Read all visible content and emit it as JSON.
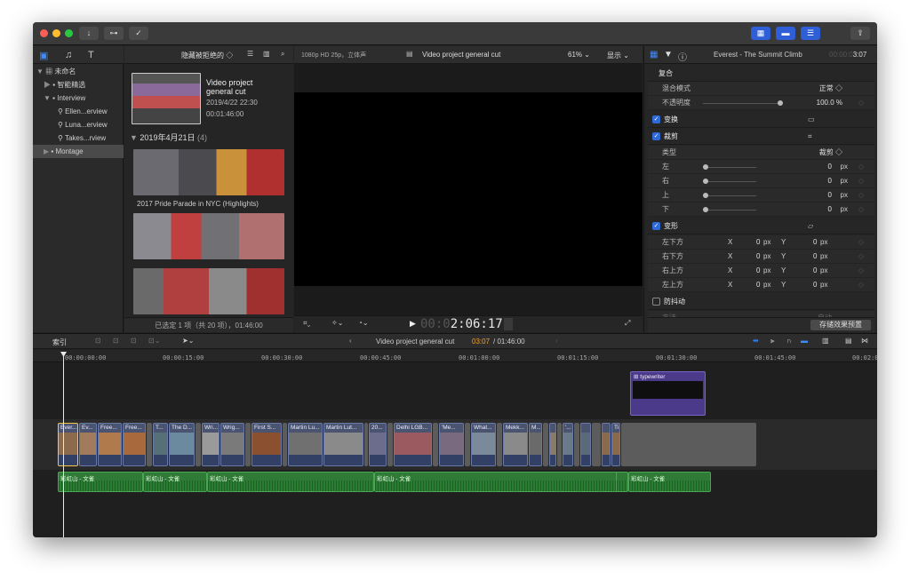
{
  "titlebar": {
    "download_icon": "download-icon",
    "key_icon": "key-icon",
    "check_icon": "checkmark-circle-icon",
    "share_icon": "share-icon"
  },
  "library": {
    "root": "未命名",
    "items": [
      {
        "label": "智能精选",
        "indent": 1
      },
      {
        "label": "Interview",
        "indent": 1
      },
      {
        "label": "Ellen...erview",
        "indent": 2
      },
      {
        "label": "Luna...erview",
        "indent": 2
      },
      {
        "label": "Takes...rview",
        "indent": 2
      },
      {
        "label": "Montage",
        "indent": 1
      }
    ]
  },
  "browser": {
    "filter": "隐藏被拒绝的 ◇",
    "project": {
      "name_line1": "Video project",
      "name_line2": "general cut",
      "date": "2019/4/22 22:30",
      "duration": "00:01:46:00"
    },
    "group_header": "2019年4月21日",
    "group_count": "(4)",
    "clip1_label": "2017 Pride Parade in NYC (Highlights)",
    "status": "已选定 1 项（共 20 项），01:46:00"
  },
  "viewer": {
    "format": "1080p HD 25p，立体声",
    "title": "Video project general cut",
    "zoom": "61%",
    "display": "显示",
    "timecode_dim": "00:0",
    "timecode": "2:06:17"
  },
  "inspector": {
    "clip_name": "Everest - The Summit Climb",
    "clip_time_dim": "00:00:0",
    "clip_time": "3:07",
    "compositing": "复合",
    "blend_label": "混合模式",
    "blend_value": "正常 ◇",
    "opacity_label": "不透明度",
    "opacity_value": "100.0 %",
    "transform": "变换",
    "crop": "裁剪",
    "crop_type_label": "类型",
    "crop_type_value": "裁剪 ◇",
    "crop_rows": [
      {
        "label": "左",
        "value": "0",
        "unit": "px"
      },
      {
        "label": "右",
        "value": "0",
        "unit": "px"
      },
      {
        "label": "上",
        "value": "0",
        "unit": "px"
      },
      {
        "label": "下",
        "value": "0",
        "unit": "px"
      }
    ],
    "distort": "变形",
    "distort_rows": [
      {
        "label": "左下方",
        "x": "0",
        "y": "0"
      },
      {
        "label": "右下方",
        "x": "0",
        "y": "0"
      },
      {
        "label": "右上方",
        "x": "0",
        "y": "0"
      },
      {
        "label": "左上方",
        "x": "0",
        "y": "0"
      }
    ],
    "stabilize": "防抖动",
    "method_label": "方法",
    "method_value": "自动",
    "save_preset": "存储效果预置"
  },
  "timeline_bar": {
    "index": "索引",
    "project_name": "Video project general cut",
    "position": "03:07",
    "duration": "/ 01:46:00"
  },
  "ruler": [
    "00:00:00:00",
    "00:00:15:00",
    "00:00:30:00",
    "00:00:45:00",
    "00:01:00:00",
    "00:01:15:00",
    "00:01:30:00",
    "00:01:45:00",
    "00:02:0"
  ],
  "title_clip": "typewriter",
  "clips": [
    {
      "label": "Ever...",
      "color": "#8c6a4c"
    },
    {
      "label": "Ev...",
      "color": "#a07b5c"
    },
    {
      "label": "Free...",
      "color": "#b07a4d"
    },
    {
      "label": "Free...",
      "color": "#a86a3c"
    },
    {
      "label": "T...",
      "color": "#567077"
    },
    {
      "label": "The D...",
      "color": "#6b8aa0"
    },
    {
      "label": "Wri...",
      "color": "#9a9a9a"
    },
    {
      "label": "Wrig...",
      "color": "#7a7a7a"
    },
    {
      "label": "First S...",
      "color": "#8a5030"
    },
    {
      "label": "Martin Lu...",
      "color": "#707070"
    },
    {
      "label": "Martin Lut...",
      "color": "#8a8a8a"
    },
    {
      "label": "20...",
      "color": "#6c6c8c"
    },
    {
      "label": "Delhi LGB...",
      "color": "#9a5a60"
    },
    {
      "label": "'Me...",
      "color": "#7a6a80"
    },
    {
      "label": "What...",
      "color": "#7a8a9a"
    },
    {
      "label": "Mekk...",
      "color": "#8a8a8a"
    },
    {
      "label": "M...",
      "color": "#6a6a6a"
    },
    {
      "label": "'...",
      "color": "#6a7a8a"
    },
    {
      "label": "Ti",
      "color": "#8a6a4a"
    }
  ],
  "audio_clips": [
    "彩虹山 - 文雀",
    "彩虹山 - 文雀",
    "彩虹山 - 文雀",
    "彩虹山 - 文雀",
    "彩虹山 - 文雀"
  ]
}
